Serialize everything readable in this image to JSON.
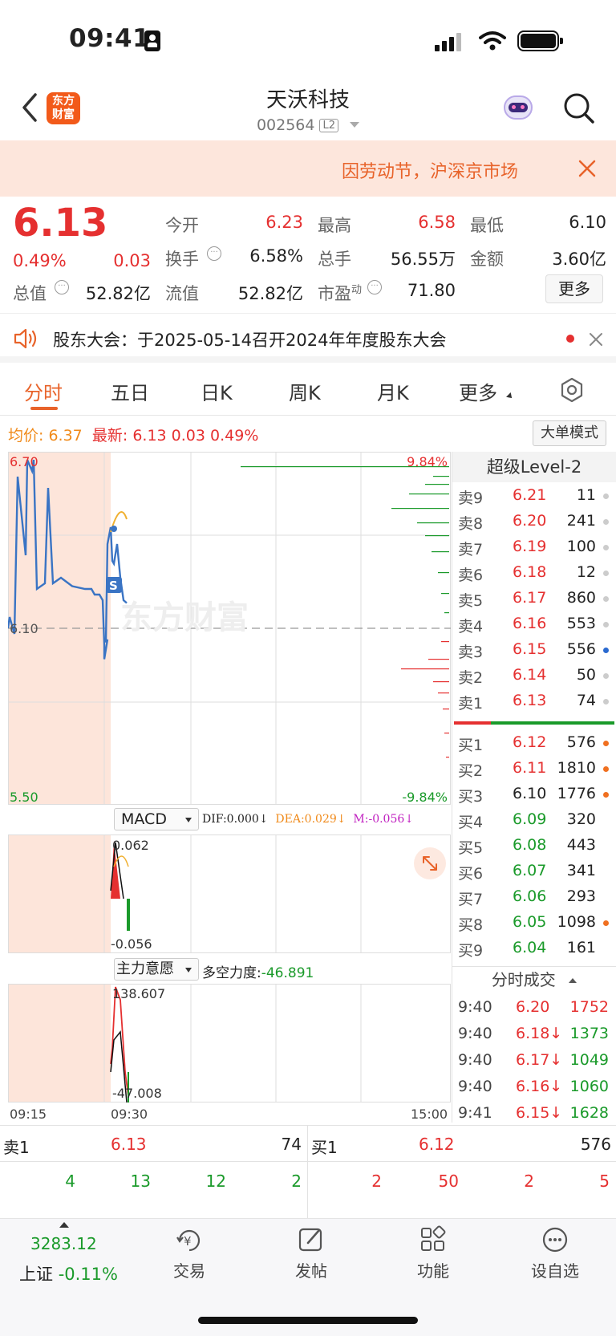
{
  "status_bar": {
    "time": "09:41"
  },
  "header": {
    "logo_line1": "东方",
    "logo_line2": "财富",
    "stock_name": "天沃科技",
    "stock_code": "002564",
    "level_badge": "L2"
  },
  "banner": {
    "text": "因劳动节，沪深京市场"
  },
  "quote": {
    "price": "6.13",
    "change_pct": "0.49%",
    "change": "0.03",
    "open_label": "今开",
    "open": "6.23",
    "high_label": "最高",
    "high": "6.58",
    "low_label": "最低",
    "low": "6.10",
    "turnover_label": "换手",
    "turnover": "6.58%",
    "volume_label": "总手",
    "volume": "56.55万",
    "amount_label": "金额",
    "amount": "3.60亿",
    "mktcap_label": "总值",
    "mktcap": "52.82亿",
    "float_label": "流值",
    "float": "52.82亿",
    "pe_label": "市盈",
    "pe_sup": "动",
    "pe": "71.80",
    "more_button": "更多"
  },
  "notice": {
    "text": "股东大会：于2025-05-14召开2024年年度股东大会"
  },
  "tabs": [
    "分时",
    "五日",
    "日K",
    "周K",
    "月K",
    "更多"
  ],
  "chart_info": {
    "avg_label": "均价:",
    "avg": "6.37",
    "latest_label": "最新:",
    "latest": "6.13",
    "latest_change": "0.03",
    "latest_pct": "0.49%",
    "big_order_button": "大单模式"
  },
  "chart_data": {
    "type": "line",
    "y_max_label": "6.70",
    "y_ref_label": "6.10",
    "y_min_label": "5.50",
    "pct_max_label": "9.84%",
    "pct_min_label": "-9.84%",
    "ylim": [
      5.5,
      6.7
    ],
    "ref": 6.1,
    "watermark": "东方财富",
    "x_labels": [
      "09:15",
      "09:30",
      "15:00"
    ],
    "series": [
      {
        "values": [
          6.1,
          6.14,
          6.08,
          6.64,
          6.36,
          6.7,
          6.66,
          6.7,
          6.24,
          6.26,
          6.6,
          6.26,
          6.28,
          6.25,
          6.24,
          6.24,
          6.22,
          6.22,
          6.2,
          6.04,
          5.99,
          6.06,
          6.05,
          6.4,
          6.46,
          6.34,
          6.33,
          6.4,
          6.28,
          6.2,
          6.19
        ]
      }
    ],
    "macd": {
      "indicator_label": "MACD",
      "dif": "DIF:0.000",
      "dea": "DEA:0.029",
      "m": "M:-0.056",
      "max_label": "0.062",
      "min_label": "-0.056"
    },
    "force": {
      "indicator_label": "主力意愿",
      "power_label": "多空力度:",
      "power": "-46.891",
      "max_label": "138.607",
      "min_label": "-47.008"
    }
  },
  "orderbook": {
    "title": "超级Level-2",
    "sell": [
      {
        "label": "卖9",
        "price": "6.21",
        "vol": "11"
      },
      {
        "label": "卖8",
        "price": "6.20",
        "vol": "241"
      },
      {
        "label": "卖7",
        "price": "6.19",
        "vol": "100"
      },
      {
        "label": "卖6",
        "price": "6.18",
        "vol": "12"
      },
      {
        "label": "卖5",
        "price": "6.17",
        "vol": "860"
      },
      {
        "label": "卖4",
        "price": "6.16",
        "vol": "553"
      },
      {
        "label": "卖3",
        "price": "6.15",
        "vol": "556"
      },
      {
        "label": "卖2",
        "price": "6.14",
        "vol": "50"
      },
      {
        "label": "卖1",
        "price": "6.13",
        "vol": "74"
      }
    ],
    "buy": [
      {
        "label": "买1",
        "price": "6.12",
        "vol": "576"
      },
      {
        "label": "买2",
        "price": "6.11",
        "vol": "1810"
      },
      {
        "label": "买3",
        "price": "6.10",
        "vol": "1776"
      },
      {
        "label": "买4",
        "price": "6.09",
        "vol": "320"
      },
      {
        "label": "买5",
        "price": "6.08",
        "vol": "443"
      },
      {
        "label": "买6",
        "price": "6.07",
        "vol": "341"
      },
      {
        "label": "买7",
        "price": "6.06",
        "vol": "293"
      },
      {
        "label": "买8",
        "price": "6.05",
        "vol": "1098"
      },
      {
        "label": "买9",
        "price": "6.04",
        "vol": "161"
      }
    ],
    "ticks_title": "分时成交",
    "ticks": [
      {
        "time": "9:40",
        "price": "6.20",
        "vol": "1752",
        "arrow": ""
      },
      {
        "time": "9:40",
        "price": "6.18",
        "vol": "1373",
        "arrow": "↓"
      },
      {
        "time": "9:40",
        "price": "6.17",
        "vol": "1049",
        "arrow": "↓"
      },
      {
        "time": "9:40",
        "price": "6.16",
        "vol": "1060",
        "arrow": "↓"
      },
      {
        "time": "9:41",
        "price": "6.15",
        "vol": "1628",
        "arrow": "↓"
      }
    ]
  },
  "bottom_quote": {
    "sell_label": "卖1",
    "sell_price": "6.13",
    "sell_vol": "74",
    "buy_label": "买1",
    "buy_price": "6.12",
    "buy_vol": "576",
    "left_row": [
      "4",
      "13",
      "12",
      "2"
    ],
    "right_row": [
      "2",
      "50",
      "2",
      "5"
    ]
  },
  "tabbar": {
    "index_value": "3283.12",
    "index_name": "上证",
    "index_change": "-0.11%",
    "items": [
      "交易",
      "发帖",
      "功能",
      "设自选"
    ]
  }
}
